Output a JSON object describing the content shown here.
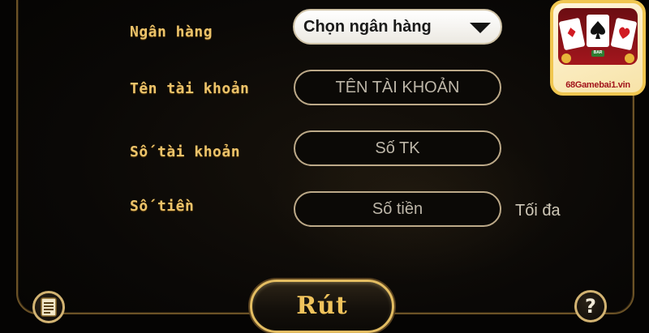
{
  "form": {
    "bank_label": "Ngân hàng",
    "bank_select_value": "Chọn ngân hàng",
    "account_name_label": "Tên tài khoản",
    "account_name_placeholder": "TÊN TÀI KHOẢN",
    "account_number_label": "Số tài khoản",
    "account_number_placeholder": "Số TK",
    "amount_label": "Số tiền",
    "amount_placeholder": "Số tiền",
    "max_label": "Tối đa"
  },
  "actions": {
    "withdraw_label": "Rút",
    "help_label": "?"
  },
  "icons": {
    "history": "document-list-icon",
    "help": "question-icon",
    "dropdown": "chevron-down-icon"
  },
  "logo": {
    "site": "68Gamebai1.vin",
    "chip_text": "BAR"
  },
  "colors": {
    "gold_text": "#ecc36a",
    "panel_border": "#6b5226",
    "logo_red": "#a2141b"
  }
}
